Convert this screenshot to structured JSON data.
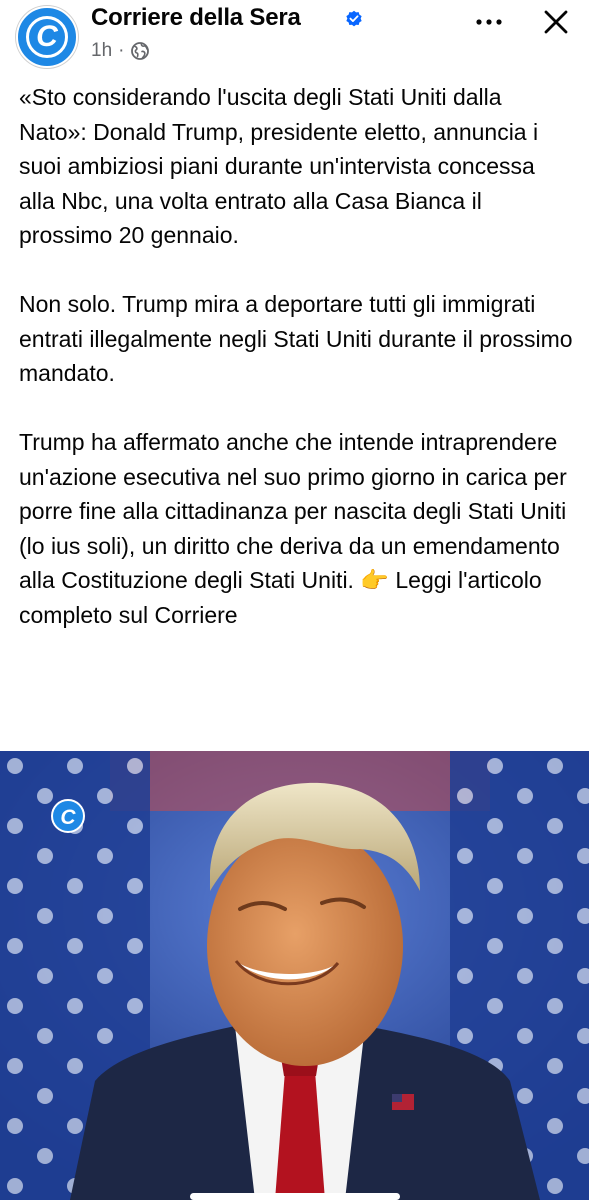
{
  "header": {
    "page_name": "Corriere della Sera",
    "avatar_letter": "C",
    "timestamp": "1h",
    "separator": "·",
    "audience_icon": "globe-icon",
    "verified_icon": "verified-badge-icon",
    "more_icon": "more-options-icon",
    "close_icon": "close-icon"
  },
  "post": {
    "paragraphs": [
      "«Sto considerando l'uscita degli Stati Uniti dalla Nato»: Donald Trump, presidente eletto, annuncia i suoi ambiziosi piani durante un'intervista concessa alla Nbc, una volta entrato alla Casa Bianca il prossimo 20 gennaio.",
      "Non solo. Trump mira a deportare tutti gli immigrati entrati illegalmente negli Stati Uniti durante il prossimo mandato.",
      "Trump ha affermato anche che intende intraprendere un'azione esecutiva nel suo primo giorno in carica per porre fine alla cittadinanza per nascita degli Stati Uniti (lo ius soli), un diritto che deriva da un emendamento alla Costituzione degli Stati Uniti. 👉 Leggi l'articolo completo sul Corriere"
    ]
  },
  "photo": {
    "watermark_letter": "C"
  },
  "colors": {
    "brand_blue": "#1e88e5",
    "verified_blue": "#0866ff",
    "text": "#050505",
    "meta": "#65676b",
    "tie_red": "#b3121f",
    "suit_navy": "#1d2745"
  }
}
